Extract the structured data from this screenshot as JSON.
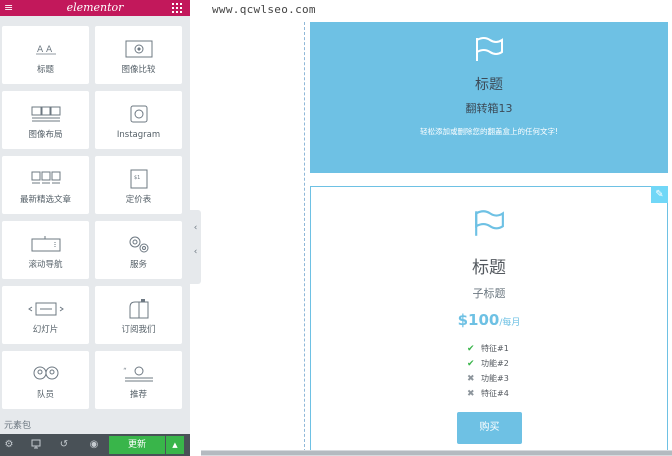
{
  "panel": {
    "logo": "elementor",
    "widgets": [
      {
        "label": "标题",
        "icon": "heading-icon"
      },
      {
        "label": "图像比较",
        "icon": "image-compare-icon"
      },
      {
        "label": "图像布局",
        "icon": "image-gallery-icon"
      },
      {
        "label": "Instagram",
        "icon": "instagram-icon"
      },
      {
        "label": "最新精选文章",
        "icon": "posts-icon"
      },
      {
        "label": "定价表",
        "icon": "price-table-icon"
      },
      {
        "label": "滚动导航",
        "icon": "scroll-nav-icon"
      },
      {
        "label": "服务",
        "icon": "gears-icon"
      },
      {
        "label": "幻灯片",
        "icon": "slides-icon"
      },
      {
        "label": "订阅我们",
        "icon": "mailbox-icon"
      },
      {
        "label": "队员",
        "icon": "team-icon"
      },
      {
        "label": "推荐",
        "icon": "testimonial-icon"
      }
    ],
    "section_label": "元素包",
    "publish_label": "更新"
  },
  "canvas": {
    "watermark": "www.qcwlseo.com",
    "flip_box": {
      "title": "标题",
      "subtitle": "翻转箱13",
      "description": "轻松添加或删除您的翻盖盒上的任何文字!"
    },
    "price_table": {
      "title": "标题",
      "subtitle": "子标题",
      "price": "$100",
      "period": "/每月",
      "features": [
        {
          "text": "特征#1",
          "included": true
        },
        {
          "text": "功能#2",
          "included": true
        },
        {
          "text": "功能#3",
          "included": false
        },
        {
          "text": "特征#4",
          "included": false
        }
      ],
      "button_label": "购买"
    }
  },
  "colors": {
    "brand": "#c2185b",
    "accent": "#6ec1e4",
    "publish": "#39b54a",
    "panel_bg": "#e6e9ec"
  }
}
